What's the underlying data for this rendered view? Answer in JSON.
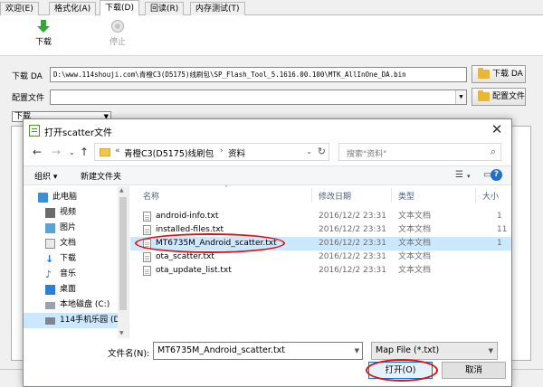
{
  "app": {
    "tabs": [
      {
        "label": "欢迎(E)"
      },
      {
        "label": "格式化(A)"
      },
      {
        "label": "下载(D)"
      },
      {
        "label": "回读(R)"
      },
      {
        "label": "内存测试(T)"
      }
    ],
    "toolbar": {
      "download_label": "下载",
      "stop_label": "停止"
    },
    "da": {
      "label": "下载 DA",
      "path": "D:\\www.114shouji.com\\青橙C3(D5175)线刷包\\SP_Flash_Tool_5.1616.00.100\\MTK_AllInOne_DA.bin",
      "button_label": "下载 DA"
    },
    "scatter": {
      "label": "配置文件",
      "path": "",
      "button_label": "配置文件"
    },
    "mode": {
      "selected": "下载"
    }
  },
  "dialog": {
    "title": "打开scatter文件",
    "address": {
      "prefix": "«",
      "segments": [
        "青橙C3(D5175)线刷包",
        "资料"
      ]
    },
    "search_placeholder": "搜索\"资料\"",
    "commands": {
      "organize": "组织 ▾",
      "new_folder": "新建文件夹"
    },
    "nav_items": [
      {
        "label": "此电脑",
        "icon": "computer-icon"
      },
      {
        "label": "视频",
        "icon": "video-icon"
      },
      {
        "label": "图片",
        "icon": "picture-icon"
      },
      {
        "label": "文档",
        "icon": "document-icon"
      },
      {
        "label": "下载",
        "icon": "download-icon"
      },
      {
        "label": "音乐",
        "icon": "music-icon"
      },
      {
        "label": "桌面",
        "icon": "desktop-icon"
      },
      {
        "label": "本地磁盘 (C:)",
        "icon": "drive-icon"
      },
      {
        "label": "114手机乐园 (D:",
        "icon": "drive-icon"
      }
    ],
    "columns": {
      "name": "名称",
      "modified": "修改日期",
      "type": "类型",
      "size": "大小"
    },
    "files": [
      {
        "name": "android-info.txt",
        "modified": "2016/12/2 23:31",
        "type": "文本文档",
        "size": "1"
      },
      {
        "name": "installed-files.txt",
        "modified": "2016/12/2 23:31",
        "type": "文本文档",
        "size": "11"
      },
      {
        "name": "MT6735M_Android_scatter.txt",
        "modified": "2016/12/2 23:31",
        "type": "文本文档",
        "size": "1"
      },
      {
        "name": "ota_scatter.txt",
        "modified": "2016/12/2 23:31",
        "type": "文本文档",
        "size": ""
      },
      {
        "name": "ota_update_list.txt",
        "modified": "2016/12/2 23:31",
        "type": "文本文档",
        "size": ""
      }
    ],
    "filename_label": "文件名(N):",
    "filename_value": "MT6735M_Android_scatter.txt",
    "filetype_value": "Map File (*.txt)",
    "open_button": "打开(O)",
    "cancel_button": "取消",
    "colors": {
      "selection": "#cce8ff",
      "annotation": "#dd1111",
      "accent": "#0078d7"
    }
  }
}
